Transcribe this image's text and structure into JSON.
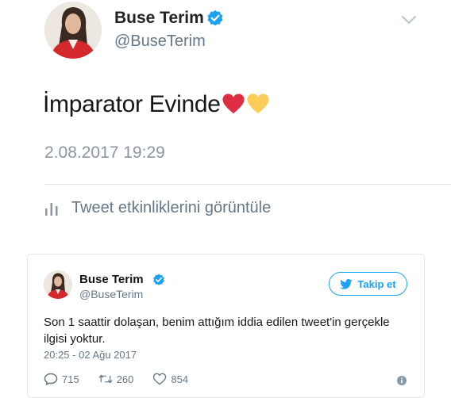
{
  "screenshot_tweet": {
    "user_name": "Buse Terim",
    "handle": "@BuseTerim",
    "text": "İmparator Evinde",
    "emojis": [
      "red-heart",
      "yellow-heart"
    ],
    "timestamp": "2.08.2017 19:29",
    "activity_label": "Tweet etkinliklerini görüntüle"
  },
  "embedded_tweet": {
    "user_name": "Buse Terim",
    "handle": "@BuseTerim",
    "follow_label": "Takip et",
    "text": "Son 1 saattir dolaşan, benim attığım iddia edilen tweet'in gerçekle ilgisi yoktur.",
    "timestamp": "20:25 - 02 Ağu 2017",
    "replies": "715",
    "retweets": "260",
    "likes": "854"
  },
  "colors": {
    "accent": "#1da1f2",
    "secondary_text": "#657786",
    "border": "#e1e8ed",
    "heart_red": "#dd2e44",
    "heart_yellow": "#fdcb58"
  }
}
